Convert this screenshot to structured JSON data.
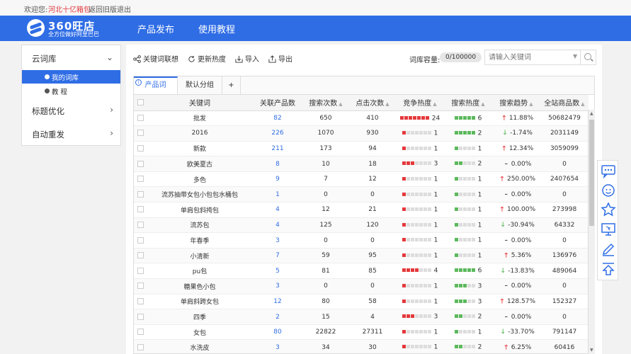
{
  "topbar": {
    "welcome": "欢迎您:",
    "user": "河北十亿箱包",
    "old_version": "返回旧版",
    "logout": "退出"
  },
  "header": {
    "brand": "360旺店",
    "slogan": "全方位做好阿里巴巴",
    "nav": [
      "产品发布",
      "使用教程"
    ]
  },
  "sidebar": {
    "sections": [
      {
        "label": "云词库",
        "chevron": "⌄"
      },
      {
        "label": "标题优化",
        "chevron": "›"
      },
      {
        "label": "自动重发",
        "chevron": "›"
      }
    ],
    "sub_items": [
      {
        "label": "我的词库",
        "active": true
      },
      {
        "label": "教 程",
        "active": false
      }
    ]
  },
  "toolbar": {
    "associate": "关键词联想",
    "refresh": "更新热度",
    "import": "导入",
    "export": "导出",
    "capacity_label": "词库容量:",
    "capacity_value": "0/100000",
    "search_placeholder": "请输入关键词"
  },
  "tabs": [
    {
      "label": "产品词",
      "active": true
    },
    {
      "label": "默认分组",
      "active": false
    },
    {
      "label": "+",
      "active": false
    }
  ],
  "table": {
    "columns": [
      "关键词",
      "关联产品数",
      "搜索次数",
      "点击次数",
      "竞争热度",
      "搜索热度",
      "搜索趋势",
      "全站商品数"
    ],
    "rows": [
      {
        "keyword": "批发",
        "related": "82",
        "searches": "650",
        "clicks": "410",
        "comp": 7,
        "comp_val": "24",
        "heat": 5,
        "heat_val": "6",
        "trend": "up",
        "trend_val": "11.88%",
        "total": "50682479"
      },
      {
        "keyword": "2016",
        "related": "226",
        "searches": "1070",
        "clicks": "930",
        "comp": 1,
        "comp_val": "1",
        "heat": 5,
        "heat_val": "2",
        "trend": "down",
        "trend_val": "-1.74%",
        "total": "2031149"
      },
      {
        "keyword": "新款",
        "related": "211",
        "searches": "173",
        "clicks": "94",
        "comp": 1,
        "comp_val": "1",
        "heat": 1,
        "heat_val": "1",
        "trend": "up",
        "trend_val": "12.34%",
        "total": "3059099"
      },
      {
        "keyword": "欧美夏古",
        "related": "8",
        "searches": "10",
        "clicks": "18",
        "comp": 3,
        "comp_val": "3",
        "heat": 2,
        "heat_val": "2",
        "trend": "flat",
        "trend_val": "0.00%",
        "total": "0"
      },
      {
        "keyword": "多色",
        "related": "9",
        "searches": "7",
        "clicks": "12",
        "comp": 1,
        "comp_val": "1",
        "heat": 1,
        "heat_val": "1",
        "trend": "up",
        "trend_val": "250.00%",
        "total": "2407654"
      },
      {
        "keyword": "流苏抽带女包小包包水桶包",
        "related": "1",
        "searches": "0",
        "clicks": "0",
        "comp": 1,
        "comp_val": "1",
        "heat": 1,
        "heat_val": "1",
        "trend": "flat",
        "trend_val": "0.00%",
        "total": "0"
      },
      {
        "keyword": "单肩包斜挎包",
        "related": "4",
        "searches": "12",
        "clicks": "21",
        "comp": 1,
        "comp_val": "1",
        "heat": 1,
        "heat_val": "1",
        "trend": "up",
        "trend_val": "100.00%",
        "total": "273998"
      },
      {
        "keyword": "流苏包",
        "related": "4",
        "searches": "125",
        "clicks": "120",
        "comp": 1,
        "comp_val": "1",
        "heat": 1,
        "heat_val": "1",
        "trend": "down",
        "trend_val": "-30.94%",
        "total": "64332"
      },
      {
        "keyword": "年春季",
        "related": "3",
        "searches": "0",
        "clicks": "0",
        "comp": 1,
        "comp_val": "1",
        "heat": 1,
        "heat_val": "1",
        "trend": "flat",
        "trend_val": "0.00%",
        "total": "0"
      },
      {
        "keyword": "小清新",
        "related": "7",
        "searches": "59",
        "clicks": "95",
        "comp": 1,
        "comp_val": "1",
        "heat": 1,
        "heat_val": "1",
        "trend": "up",
        "trend_val": "5.36%",
        "total": "136976"
      },
      {
        "keyword": "pu包",
        "related": "5",
        "searches": "81",
        "clicks": "85",
        "comp": 4,
        "comp_val": "4",
        "heat": 5,
        "heat_val": "6",
        "trend": "down",
        "trend_val": "-13.83%",
        "total": "489064"
      },
      {
        "keyword": "糖果色小包",
        "related": "3",
        "searches": "0",
        "clicks": "0",
        "comp": 1,
        "comp_val": "1",
        "heat": 3,
        "heat_val": "3",
        "trend": "flat",
        "trend_val": "0.00%",
        "total": "0"
      },
      {
        "keyword": "单肩斜跨女包",
        "related": "12",
        "searches": "80",
        "clicks": "58",
        "comp": 1,
        "comp_val": "1",
        "heat": 3,
        "heat_val": "3",
        "trend": "up",
        "trend_val": "128.57%",
        "total": "152327"
      },
      {
        "keyword": "四季",
        "related": "2",
        "searches": "15",
        "clicks": "4",
        "comp": 3,
        "comp_val": "3",
        "heat": 2,
        "heat_val": "2",
        "trend": "flat",
        "trend_val": "0.00%",
        "total": "0"
      },
      {
        "keyword": "女包",
        "related": "80",
        "searches": "22822",
        "clicks": "27311",
        "comp": 1,
        "comp_val": "1",
        "heat": 1,
        "heat_val": "1",
        "trend": "down",
        "trend_val": "-33.70%",
        "total": "791147"
      },
      {
        "keyword": "水洗皮",
        "related": "3",
        "searches": "34",
        "clicks": "30",
        "comp": 1,
        "comp_val": "1",
        "heat": 2,
        "heat_val": "2",
        "trend": "up",
        "trend_val": "6.25%",
        "total": "60416"
      }
    ]
  },
  "colors": {
    "brand": "#2f6de5",
    "up": "#e4393c",
    "down": "#5cb85c"
  },
  "floatbar_icons": [
    "chat-bubble-icon",
    "customer-service-icon",
    "star-icon",
    "screen-share-icon",
    "edit-pencil-icon",
    "back-to-top-icon"
  ]
}
